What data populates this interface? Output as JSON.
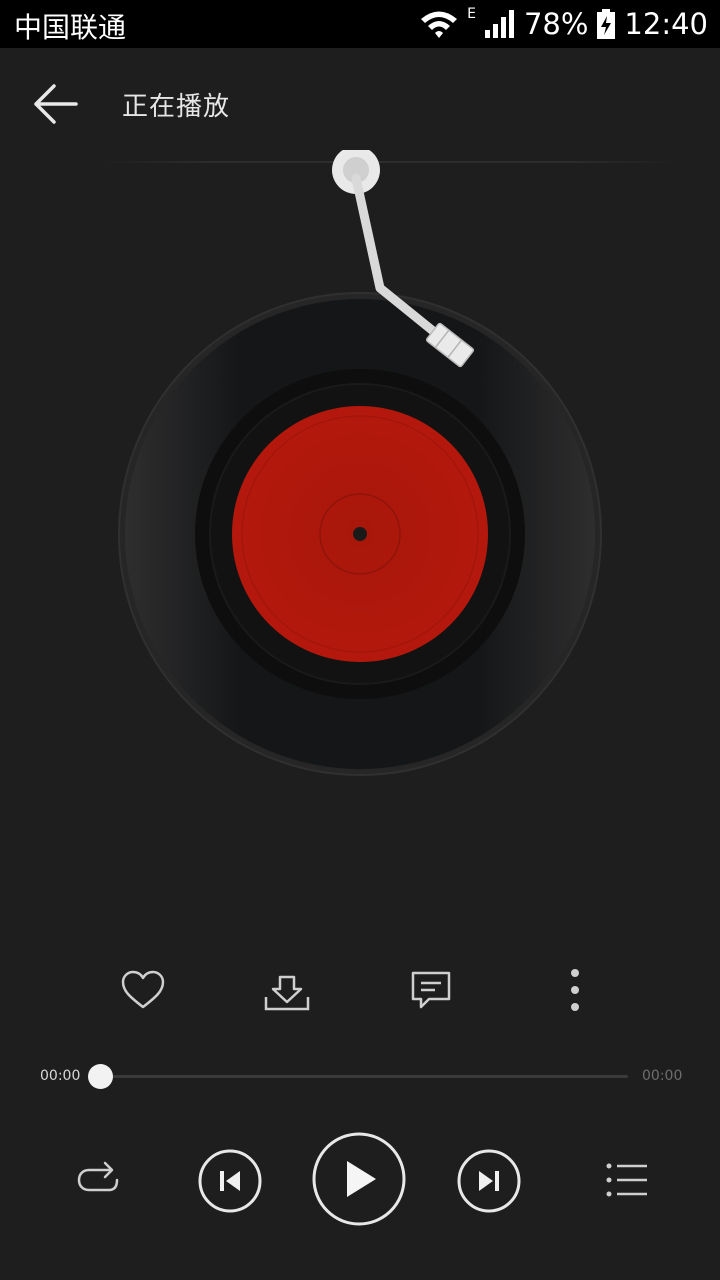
{
  "status_bar": {
    "carrier": "中国联通",
    "network_type": "E",
    "battery": "78%",
    "time": "12:40"
  },
  "header": {
    "title": "正在播放"
  },
  "player": {
    "current_time": "00:00",
    "total_time": "00:00",
    "progress_fraction": 0.0
  },
  "icons": {
    "back": "arrow-left-icon",
    "like": "heart-icon",
    "download": "download-icon",
    "comment": "comment-icon",
    "more": "more-vertical-icon",
    "repeat": "repeat-icon",
    "previous": "skip-previous-icon",
    "play": "play-icon",
    "next": "skip-next-icon",
    "playlist": "playlist-icon"
  },
  "colors": {
    "background": "#1e1e1f",
    "vinyl_label": "#b0160c",
    "time_current": "#d8d8d8",
    "time_total": "#6e6e6e"
  }
}
